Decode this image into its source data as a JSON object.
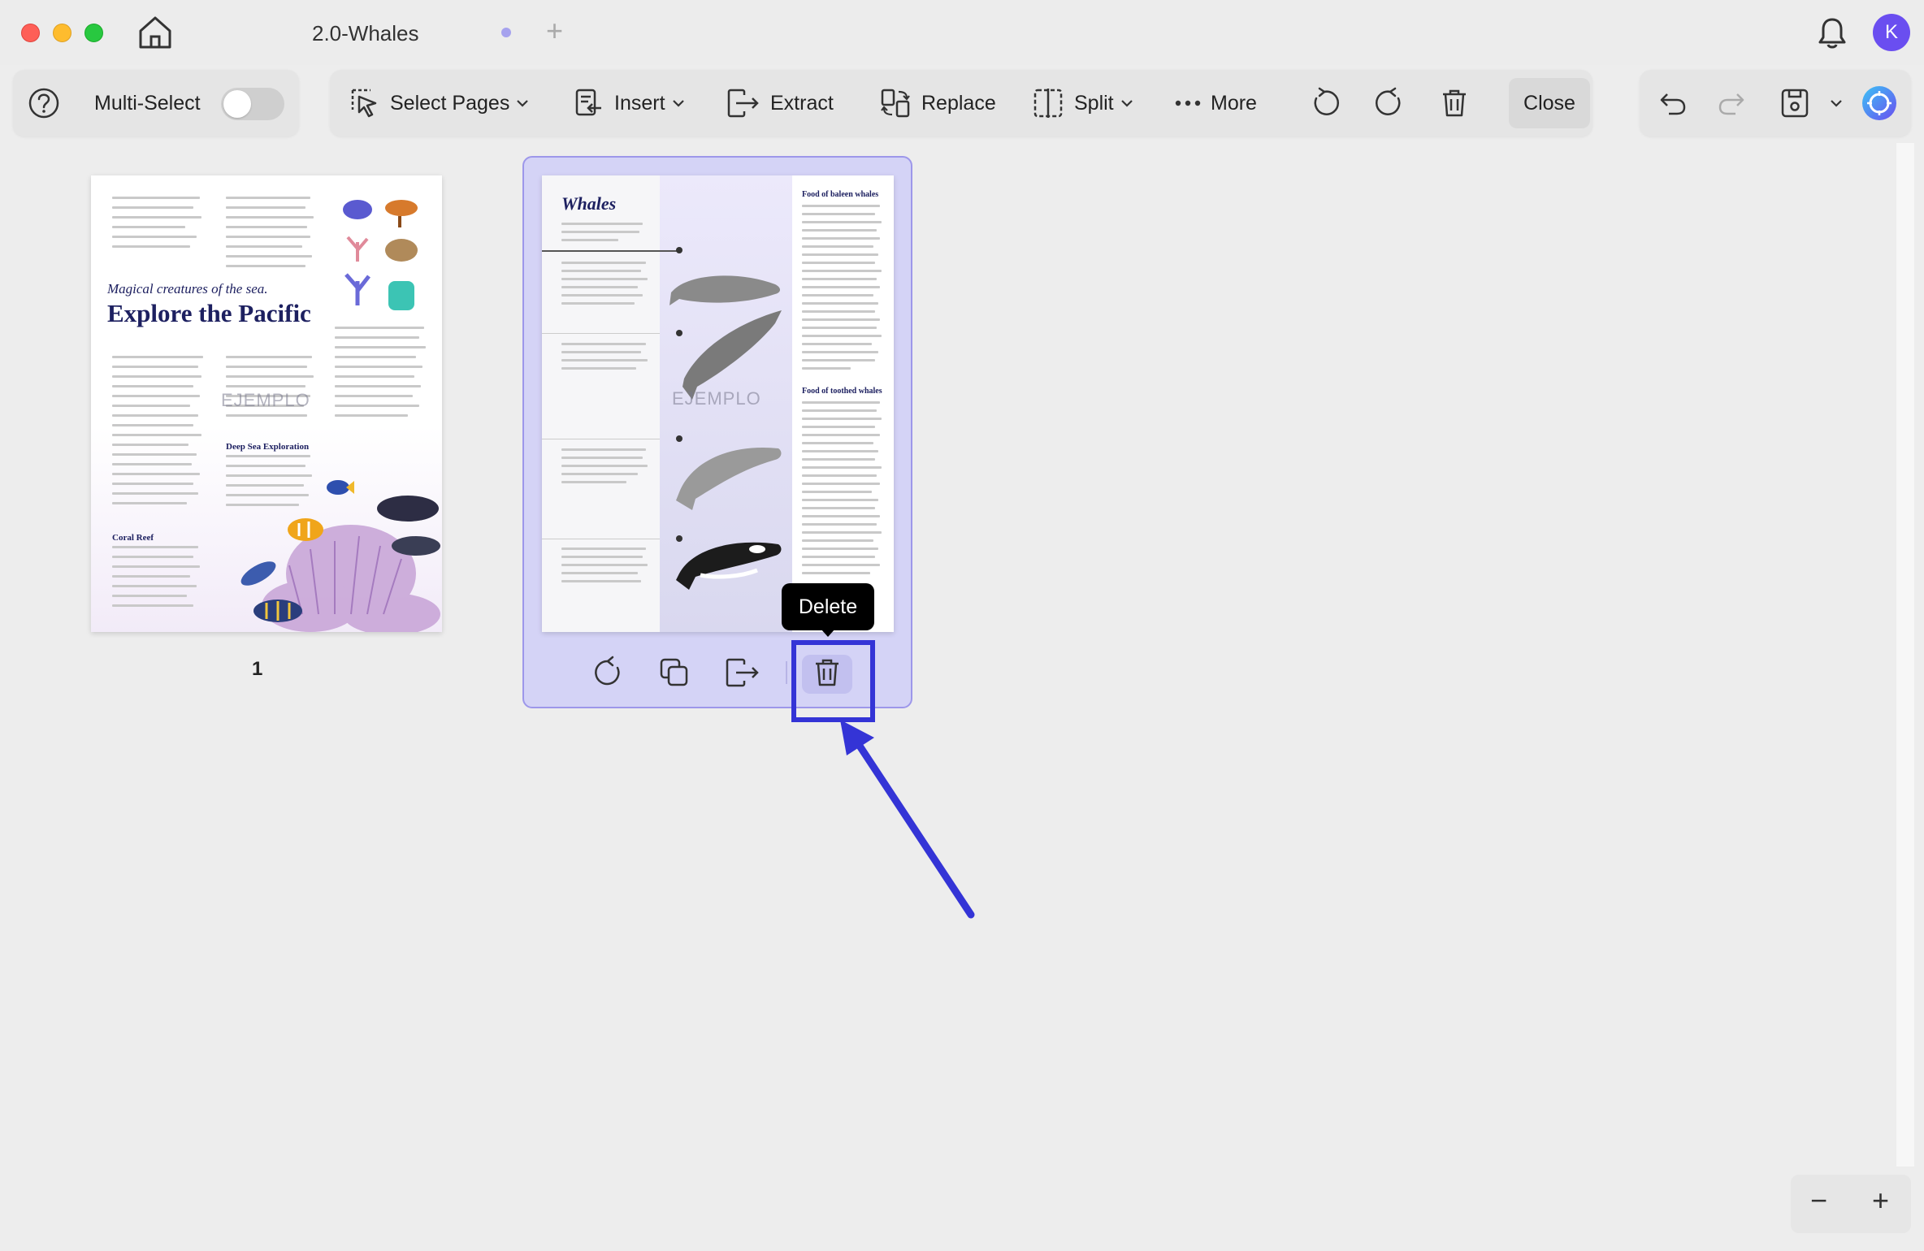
{
  "window": {
    "tab_title": "2.0-Whales",
    "add_tab_symbol": "+",
    "avatar_initial": "K"
  },
  "toolbar": {
    "multi_select_label": "Multi-Select",
    "multi_select_on": false,
    "select_pages_label": "Select Pages",
    "insert_label": "Insert",
    "extract_label": "Extract",
    "replace_label": "Replace",
    "split_label": "Split",
    "more_label": "More",
    "close_label": "Close"
  },
  "pages": [
    {
      "number": "1",
      "headline_italic": "Magical creatures of the sea.",
      "headline": "Explore the Pacific",
      "subhead_1": "Deep Sea Exploration",
      "subhead_2": "Coral Reef",
      "watermark": "EJEMPLO"
    },
    {
      "title": "Whales",
      "section_1": "Food of baleen whales",
      "section_2": "Food of toothed whales",
      "watermark": "EJEMPLO"
    }
  ],
  "tooltip": {
    "label": "Delete"
  },
  "zoom": {
    "minus": "−",
    "plus": "+"
  },
  "colors": {
    "accent": "#6a4ef0",
    "selection_fill": "#d4d3f6",
    "annotation_blue": "#3434d6",
    "heading_navy": "#1d2060"
  }
}
